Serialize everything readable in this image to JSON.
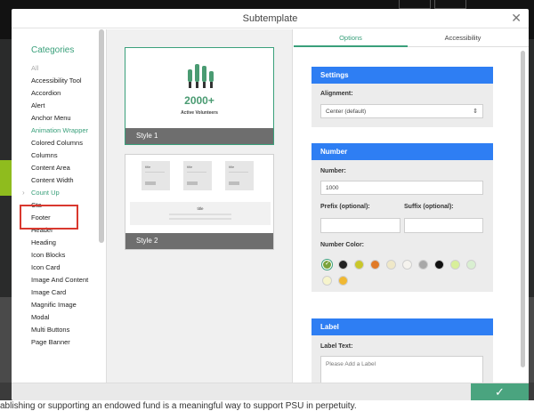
{
  "modal": {
    "title": "Subtemplate"
  },
  "categories": {
    "heading": "Categories",
    "items": [
      {
        "label": "All",
        "style": "muted"
      },
      {
        "label": "Accessibility Tool",
        "style": "normal"
      },
      {
        "label": "Accordion",
        "style": "normal"
      },
      {
        "label": "Alert",
        "style": "normal"
      },
      {
        "label": "Anchor Menu",
        "style": "normal"
      },
      {
        "label": "Animation Wrapper",
        "style": "teal"
      },
      {
        "label": "Colored Columns",
        "style": "normal"
      },
      {
        "label": "Columns",
        "style": "normal"
      },
      {
        "label": "Content Area",
        "style": "normal"
      },
      {
        "label": "Content Width",
        "style": "normal"
      },
      {
        "label": "Count Up",
        "style": "selected"
      },
      {
        "label": "Cta",
        "style": "normal"
      },
      {
        "label": "Footer",
        "style": "normal"
      },
      {
        "label": "Header",
        "style": "normal"
      },
      {
        "label": "Heading",
        "style": "normal"
      },
      {
        "label": "Icon Blocks",
        "style": "normal"
      },
      {
        "label": "Icon Card",
        "style": "normal"
      },
      {
        "label": "Image And Content",
        "style": "normal"
      },
      {
        "label": "Image Card",
        "style": "normal"
      },
      {
        "label": "Magnific Image",
        "style": "normal"
      },
      {
        "label": "Modal",
        "style": "normal"
      },
      {
        "label": "Multi Buttons",
        "style": "normal"
      },
      {
        "label": "Page Banner",
        "style": "normal"
      }
    ]
  },
  "styles": {
    "style1": {
      "label": "Style 1",
      "number": "2000+",
      "subtitle": "Active Volunteers"
    },
    "style2": {
      "label": "Style 2",
      "mini_title": "title",
      "bar_title": "title"
    }
  },
  "tabs": {
    "options": "Options",
    "accessibility": "Accessibility"
  },
  "settings": {
    "heading": "Settings",
    "alignment_label": "Alignment:",
    "alignment_value": "Center (default)"
  },
  "number": {
    "heading": "Number",
    "number_label": "Number:",
    "number_value": "1000",
    "prefix_label": "Prefix (optional):",
    "suffix_label": "Suffix (optional):",
    "color_label": "Number Color:",
    "colors": [
      "#7aa23c",
      "#222222",
      "#c9c72a",
      "#e07a27",
      "#efe8c8",
      "#f5f3ee",
      "#a8a8a8",
      "#111111",
      "#d8ef9a",
      "#d9efd1",
      "#f6f4cc",
      "#f0b832"
    ]
  },
  "label": {
    "heading": "Label",
    "text_label": "Label Text:",
    "placeholder": "Please Add a Label"
  },
  "actions": {
    "confirm": "✓"
  },
  "background": {
    "footer_text": "ablishing or supporting an endowed fund is a meaningful way to support PSU in perpetuity."
  }
}
